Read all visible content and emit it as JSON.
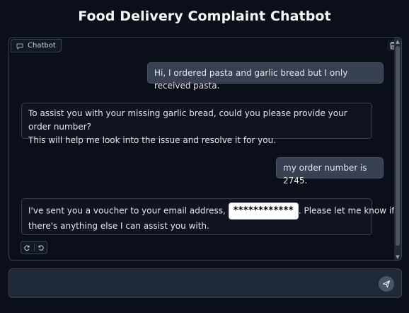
{
  "header": {
    "title": "Food Delivery Complaint Chatbot"
  },
  "chatbot": {
    "label": "Chatbot",
    "messages": [
      {
        "role": "user",
        "text": "Hi, I ordered pasta and garlic bread but I only received pasta."
      },
      {
        "role": "bot",
        "line1": "To assist you with your missing garlic bread, could you please provide your order number?",
        "line2": "This will help me look into the issue and resolve it for you."
      },
      {
        "role": "user",
        "text": "my order number is 2745."
      },
      {
        "role": "bot",
        "prefix": "I've sent you a voucher to your email address, ",
        "redacted": "************",
        "suffix": ". Please let me know if",
        "line2": "there's anything else I can assist you with."
      }
    ],
    "icons": {
      "label": "chat-bubble-icon",
      "clear": "trash-icon",
      "retry": "retry-icon",
      "undo": "undo-icon"
    }
  },
  "input": {
    "value": "",
    "placeholder": "",
    "send_icon": "send-icon"
  },
  "colors": {
    "background": "#0b0f19",
    "user_bubble": "#374151",
    "bot_bubble": "#0f1420",
    "border": "#374151"
  }
}
